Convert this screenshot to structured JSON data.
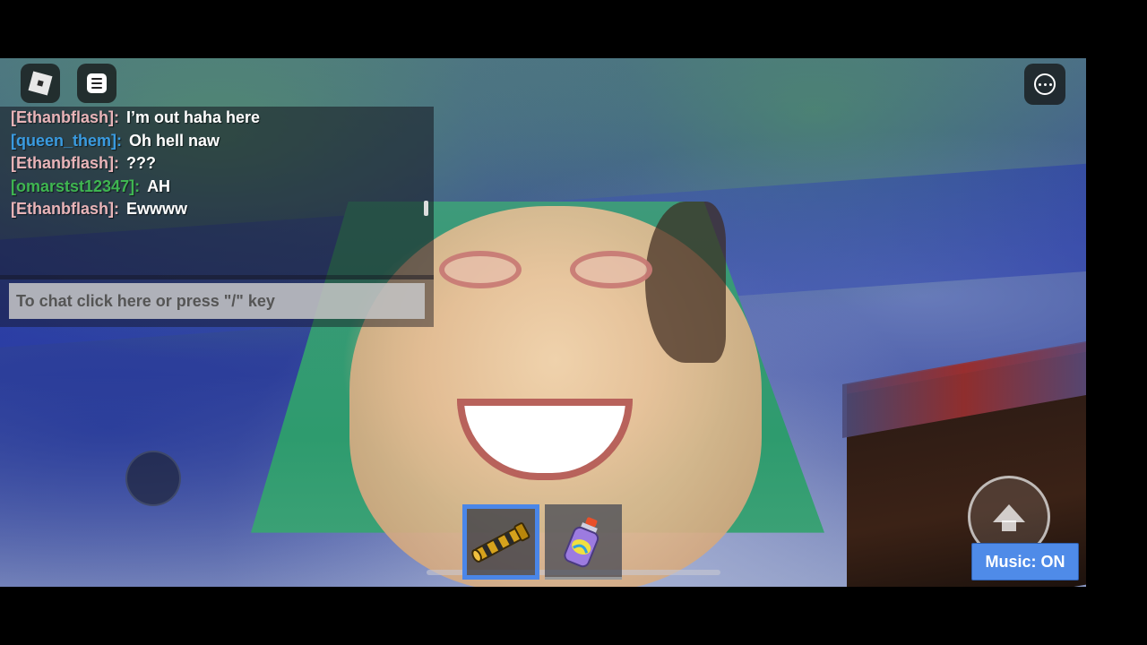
{
  "chat": {
    "messages": [
      {
        "user": "[Ethanbflash]:",
        "text": "I’m out haha here",
        "color": "#e8b4b8"
      },
      {
        "user": "[queen_them]:",
        "text": "Oh hell naw",
        "color": "#3a9be0"
      },
      {
        "user": "[Ethanbflash]:",
        "text": "???",
        "color": "#e8b4b8"
      },
      {
        "user": "[omarstst12347]:",
        "text": "AH",
        "color": "#3fb551"
      },
      {
        "user": "[Ethanbflash]:",
        "text": "Ewwww",
        "color": "#e8b4b8"
      }
    ],
    "input_placeholder": "To chat click here or press \"/\" key"
  },
  "hud": {
    "roblox_menu_icon": "roblox-logo-icon",
    "chat_toggle_icon": "chat-icon",
    "more_options_icon": "more-icon",
    "music_label": "Music: ON",
    "music_color": "#4f8be8"
  },
  "hotbar": {
    "slots": [
      {
        "item_icon": "telescope-icon",
        "selected": true
      },
      {
        "item_icon": "bottle-icon",
        "selected": false
      }
    ],
    "selected_color": "#4a86e8"
  }
}
